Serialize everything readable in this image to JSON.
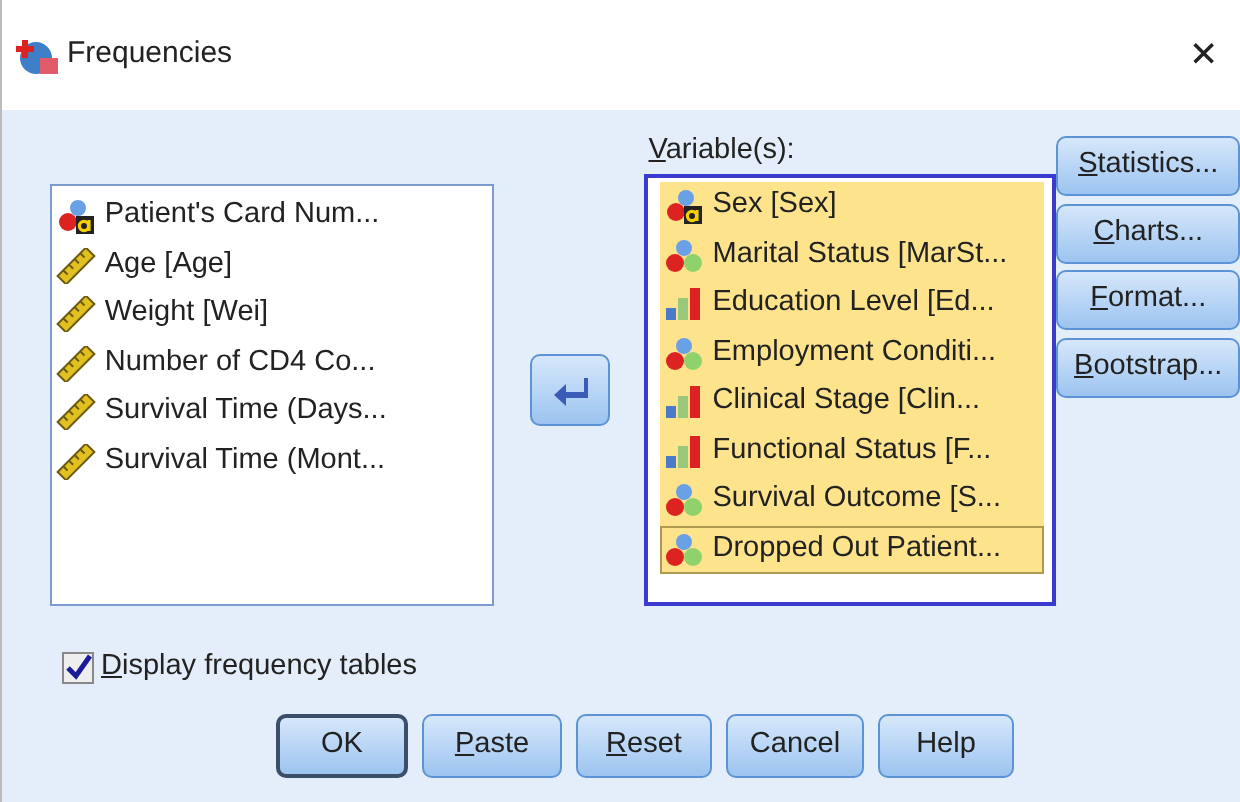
{
  "window": {
    "title": "Frequencies",
    "close": "✕"
  },
  "source_list": {
    "items": [
      {
        "label": "Patient's Card Num...",
        "kind": "string"
      },
      {
        "label": "Age [Age]",
        "kind": "scale"
      },
      {
        "label": "Weight [Wei]",
        "kind": "scale"
      },
      {
        "label": "Number of CD4 Co...",
        "kind": "scale"
      },
      {
        "label": "Survival Time (Days...",
        "kind": "scale"
      },
      {
        "label": "Survival Time (Mont...",
        "kind": "scale"
      }
    ]
  },
  "move_button": {
    "kind": "left"
  },
  "variables": {
    "label": "Variable(s):",
    "underline_first": true,
    "items": [
      {
        "label": "Sex [Sex]",
        "kind": "string",
        "selected": true,
        "focused": false
      },
      {
        "label": "Marital Status [MarSt...",
        "kind": "nominal",
        "selected": true,
        "focused": false
      },
      {
        "label": "Education Level [Ed...",
        "kind": "ordinal",
        "selected": true,
        "focused": false
      },
      {
        "label": "Employment Conditi...",
        "kind": "nominal",
        "selected": true,
        "focused": false
      },
      {
        "label": "Clinical Stage [Clin...",
        "kind": "ordinal",
        "selected": true,
        "focused": false
      },
      {
        "label": "Functional Status [F...",
        "kind": "ordinal",
        "selected": true,
        "focused": false
      },
      {
        "label": "Survival Outcome [S...",
        "kind": "nominal",
        "selected": true,
        "focused": false
      },
      {
        "label": "Dropped Out Patient...",
        "kind": "nominal",
        "selected": true,
        "focused": true
      }
    ]
  },
  "side_buttons": [
    {
      "label": "Statistics...",
      "underline_first": true
    },
    {
      "label": "Charts...",
      "underline_first": true
    },
    {
      "label": "Format...",
      "underline_first": true
    },
    {
      "label": "Bootstrap...",
      "underline_first": true
    }
  ],
  "display_frequency_tables": {
    "label": "Display frequency tables",
    "checked": true,
    "underline_first": true
  },
  "buttons": [
    {
      "label": "OK",
      "default": true,
      "underline_first": false
    },
    {
      "label": "Paste",
      "default": false,
      "underline_first": true
    },
    {
      "label": "Reset",
      "default": false,
      "underline_first": true
    },
    {
      "label": "Cancel",
      "default": false,
      "underline_first": false
    },
    {
      "label": "Help",
      "default": false,
      "underline_first": false
    }
  ]
}
